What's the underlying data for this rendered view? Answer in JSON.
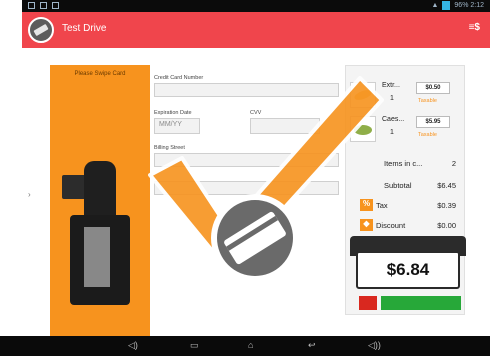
{
  "status_bar": {
    "right_text": "96% 2:12"
  },
  "action_bar": {
    "title": "Test Drive",
    "menu_label": "≡$"
  },
  "payment_form": {
    "swipe_label": "Please Swipe Card",
    "card_number_label": "Credit Card Number",
    "expiration_label": "Expiration Date",
    "expiration_placeholder": "MM/YY",
    "cvv_label": "CVV",
    "billing_street_label": "Billing Street"
  },
  "order": {
    "items": [
      {
        "name": "Extr...",
        "qty": "1",
        "price": "$0.50",
        "taxable": "Taxable",
        "thumb": "food-a"
      },
      {
        "name": "Caes...",
        "qty": "1",
        "price": "$5.95",
        "taxable": "Taxable",
        "thumb": "food-b"
      }
    ],
    "items_label": "Items in c...",
    "items_count": "2",
    "subtotal_label": "Subtotal",
    "subtotal_value": "$6.45",
    "tax_label": "Tax",
    "tax_value": "$0.39",
    "discount_label": "Discount",
    "discount_value": "$0.00",
    "total": "$6.84"
  },
  "overlay": {
    "icon": "checkmark-card-icon",
    "check_color": "#f7931e",
    "badge_color": "#6a6a6a"
  }
}
